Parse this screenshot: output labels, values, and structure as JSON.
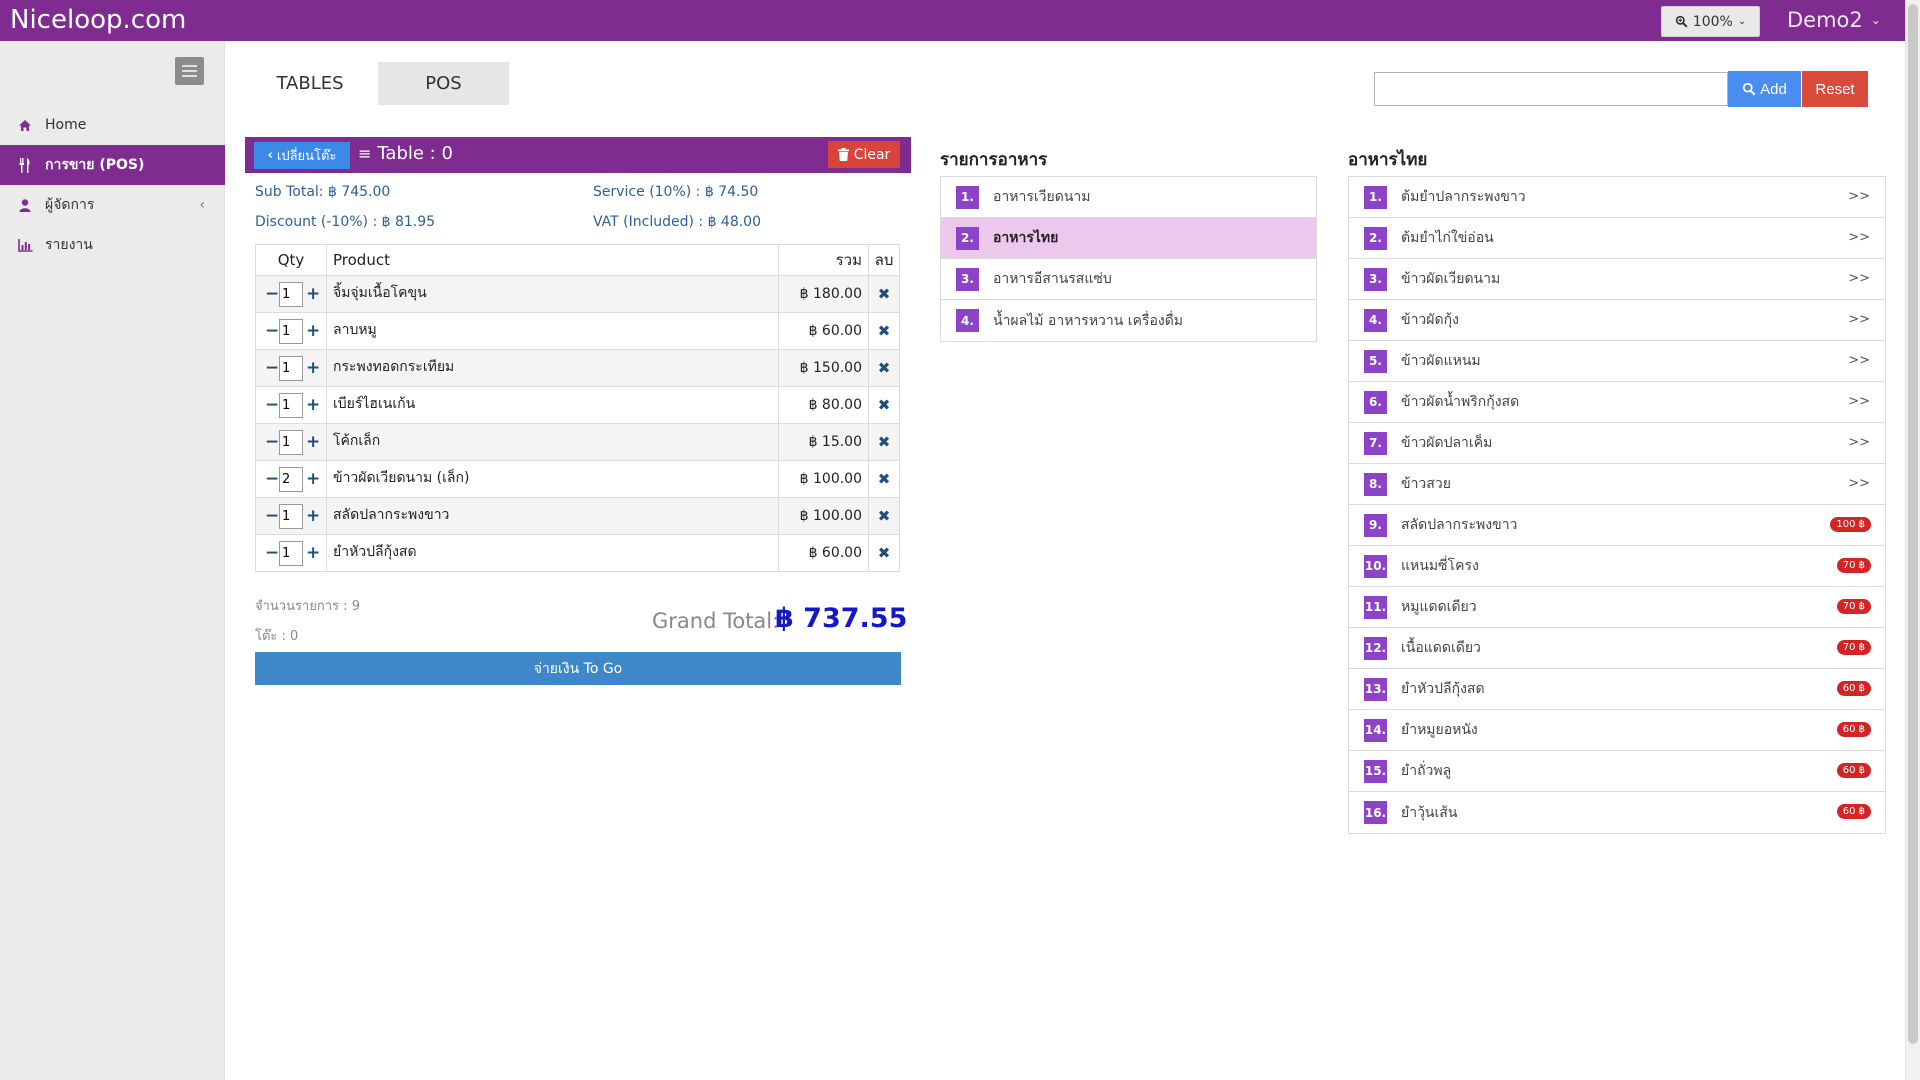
{
  "app": {
    "brand": "Niceloop.com",
    "zoom": "100%",
    "user": "Demo2"
  },
  "sidebar": {
    "items": [
      {
        "label": "Home",
        "icon": "home-icon"
      },
      {
        "label": "การขาย (POS)",
        "icon": "utensils-icon",
        "active": true
      },
      {
        "label": "ผู้จัดการ",
        "icon": "user-icon"
      },
      {
        "label": "รายงาน",
        "icon": "bar-chart-icon"
      }
    ]
  },
  "tabs": {
    "tables": "TABLES",
    "pos": "POS"
  },
  "search": {
    "value": "",
    "add_label": "Add",
    "reset_label": "Reset"
  },
  "order": {
    "change_table_label": "เปลี่ยนโต๊ะ",
    "table_label": "Table : 0",
    "clear_label": "Clear",
    "subtotal": "Sub Total: ฿ 745.00",
    "service": "Service (10%) : ฿ 74.50",
    "discount": "Discount (-10%) : ฿ 81.95",
    "vat": "VAT (Included) : ฿ 48.00",
    "columns": {
      "qty": "Qty",
      "product": "Product",
      "total": "รวม",
      "delete": "ลบ"
    },
    "items": [
      {
        "qty": "1",
        "product": "จิ้มจุ่มเนื้อโคขุน",
        "total": "฿ 180.00"
      },
      {
        "qty": "1",
        "product": "ลาบหมู",
        "total": "฿ 60.00"
      },
      {
        "qty": "1",
        "product": "กระพงทอดกระเทียม",
        "total": "฿ 150.00"
      },
      {
        "qty": "1",
        "product": "เบียร์ไฮเนเก้น",
        "total": "฿ 80.00"
      },
      {
        "qty": "1",
        "product": "โค้กเล็ก",
        "total": "฿ 15.00"
      },
      {
        "qty": "2",
        "product": "ข้าวผัดเวียดนาม (เล็ก)",
        "total": "฿ 100.00"
      },
      {
        "qty": "1",
        "product": "สลัดปลากระพงขาว",
        "total": "฿ 100.00"
      },
      {
        "qty": "1",
        "product": "ยำหัวปลีกุ้งสด",
        "total": "฿ 60.00"
      }
    ],
    "item_count": "จำนวนรายการ : 9",
    "table_meta": "โต๊ะ : 0",
    "grand_total_label": "Grand Total:",
    "grand_total_value": "฿ 737.55",
    "pay_label": "จ่ายเงิน To Go"
  },
  "categories": {
    "title": "รายการอาหาร",
    "items": [
      {
        "num": "1.",
        "label": "อาหารเวียดนาม"
      },
      {
        "num": "2.",
        "label": "อาหารไทย",
        "selected": true
      },
      {
        "num": "3.",
        "label": "อาหารอีสานรสแซ่บ"
      },
      {
        "num": "4.",
        "label": "น้ำผลไม้ อาหารหวาน เครื่องดื่ม"
      }
    ]
  },
  "menu": {
    "title": "อาหารไทย",
    "items": [
      {
        "num": "1.",
        "label": "ต้มยำปลากระพงขาว",
        "tag": ">>"
      },
      {
        "num": "2.",
        "label": "ต้มยำไก่ใข่อ่อน",
        "tag": ">>"
      },
      {
        "num": "3.",
        "label": "ข้าวผัดเวียดนาม",
        "tag": ">>"
      },
      {
        "num": "4.",
        "label": "ข้าวผัดกุ้ง",
        "tag": ">>"
      },
      {
        "num": "5.",
        "label": "ข้าวผัดแหนม",
        "tag": ">>"
      },
      {
        "num": "6.",
        "label": "ข้าวผัดน้ำพริกกุ้งสด",
        "tag": ">>"
      },
      {
        "num": "7.",
        "label": "ข้าวผัดปลาเค็ม",
        "tag": ">>"
      },
      {
        "num": "8.",
        "label": "ข้าวสวย",
        "tag": ">>"
      },
      {
        "num": "9.",
        "label": "สลัดปลากระพงขาว",
        "price": "100 ฿"
      },
      {
        "num": "10.",
        "label": "แหนมซี่โครง",
        "price": "70 ฿"
      },
      {
        "num": "11.",
        "label": "หมูแดดเดียว",
        "price": "70 ฿"
      },
      {
        "num": "12.",
        "label": "เนื้อแดดเดียว",
        "price": "70 ฿"
      },
      {
        "num": "13.",
        "label": "ยำหัวปลีกุ้งสด",
        "price": "60 ฿"
      },
      {
        "num": "14.",
        "label": "ยำหมูยอหนัง",
        "price": "60 ฿"
      },
      {
        "num": "15.",
        "label": "ยำถั่วพลู",
        "price": "60 ฿"
      },
      {
        "num": "16.",
        "label": "ยำวุ้นเส้น",
        "price": "60 ฿"
      }
    ]
  },
  "colors": {
    "brand": "#7f2c91",
    "accent_blue": "#4a8fef",
    "danger": "#d94b3b",
    "badge": "#8d43c7",
    "selected": "#ecc8ec"
  }
}
